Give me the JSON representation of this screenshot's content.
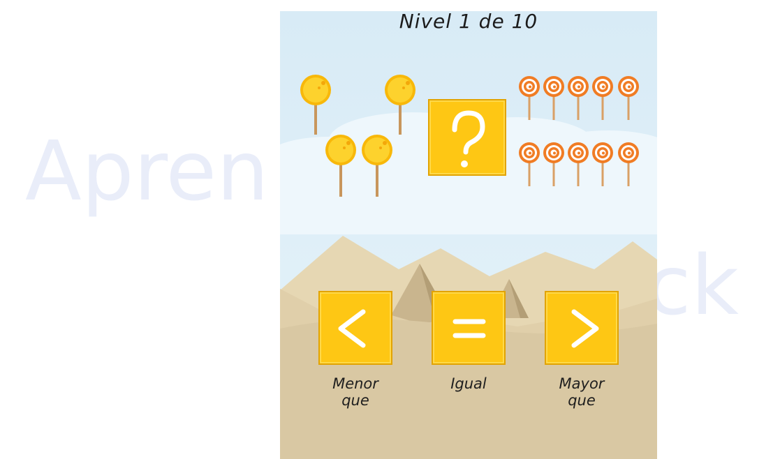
{
  "watermark": {
    "left": "Apren",
    "right": "ick"
  },
  "game": {
    "title": "Nivel 1 de 10",
    "left_group": {
      "item": "tree-icon",
      "count": 4
    },
    "right_group": {
      "item": "lollipop-icon",
      "count": 10
    },
    "comparison_box": {
      "symbol": "?"
    },
    "choices": [
      {
        "symbol": "<",
        "label_line1": "Menor",
        "label_line2": "que"
      },
      {
        "symbol": "=",
        "label_line1": "Igual",
        "label_line2": ""
      },
      {
        "symbol": ">",
        "label_line1": "Mayor",
        "label_line2": "que"
      }
    ]
  },
  "colors": {
    "button_yellow": "#fec714",
    "button_border": "#e2a300",
    "sky": "#d9ebf6",
    "sand": "#d9c8a4",
    "tree_yellow": "#f9b90c",
    "lollipop_orange": "#f07c24"
  }
}
